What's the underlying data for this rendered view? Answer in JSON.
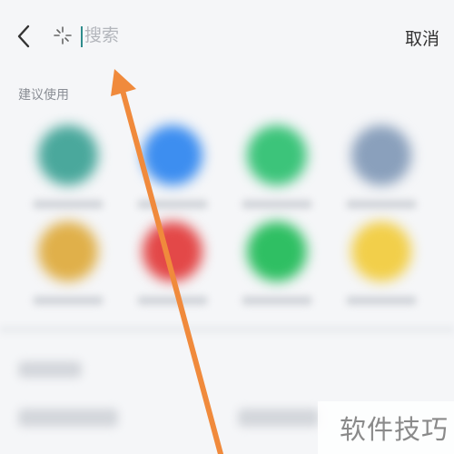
{
  "search": {
    "placeholder": "搜索",
    "cancel_label": "取消",
    "back_icon": "chevron-left-icon",
    "spark_icon": "sparkle-icon"
  },
  "suggested": {
    "title": "建议使用",
    "apps": [
      {
        "icon_color": "#4aa89c"
      },
      {
        "icon_color": "#3d8ef0"
      },
      {
        "icon_color": "#3cc47a"
      },
      {
        "icon_color": "#8aa0bc"
      },
      {
        "icon_color": "#e0b04a"
      },
      {
        "icon_color": "#e34848"
      },
      {
        "icon_color": "#2fbf63"
      },
      {
        "icon_color": "#f2cf4a"
      }
    ]
  },
  "annotation": {
    "arrow_color": "#f08a3c"
  },
  "watermark": {
    "text": "软件技巧"
  }
}
